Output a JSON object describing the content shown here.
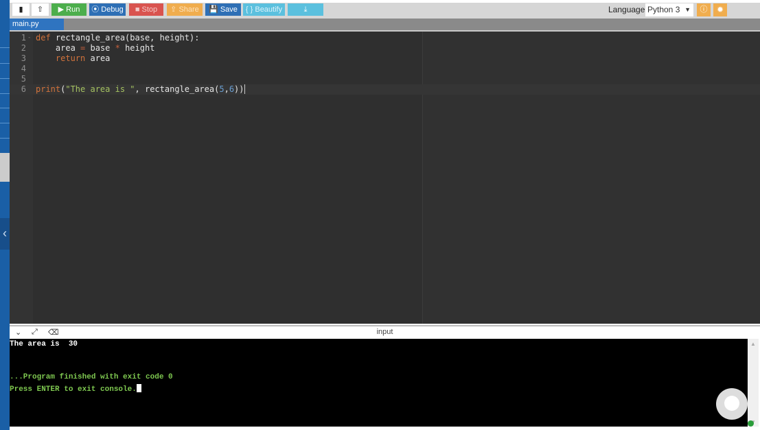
{
  "toolbar": {
    "new_file_icon": "file-icon",
    "upload_icon": "upload-icon",
    "run": "▶ Run",
    "debug": "⦿ Debug",
    "stop": "■ Stop",
    "share": "⇪ Share",
    "save": "💾 Save",
    "beautify": "{ } Beautify",
    "download": "⤓",
    "language_label": "Language",
    "language_value": "Python 3"
  },
  "tab": {
    "label": "main.py"
  },
  "code": [
    {
      "n": "1",
      "fold": "-"
    },
    {
      "n": "2"
    },
    {
      "n": "3"
    },
    {
      "n": "4"
    },
    {
      "n": "5"
    },
    {
      "n": "6"
    }
  ],
  "code_text": {
    "l1a": "def",
    "l1b": " rectangle_area(base, height):",
    "l2a": "    area ",
    "l2b": "=",
    "l2c": " base ",
    "l2d": "*",
    "l2e": " height",
    "l3a": "    ",
    "l3b": "return",
    "l3c": " area",
    "l6a": "print",
    "l6b": "(",
    "l6c": "\"The area is \"",
    "l6d": ", rectangle_area(",
    "l6e": "5",
    "l6f": ",",
    "l6g": "6",
    "l6h": "))"
  },
  "console": {
    "header": "input",
    "lines": [
      "The area is  30",
      "...Program finished with exit code 0",
      "Press ENTER to exit console."
    ]
  },
  "colors": {
    "run": "#4cae4c",
    "debug": "#2e6fb5",
    "stop": "#d9534f",
    "share": "#f0ad4e",
    "save": "#2e6fb5",
    "beautify": "#5bc0de",
    "accent": "#f0ad4e"
  }
}
